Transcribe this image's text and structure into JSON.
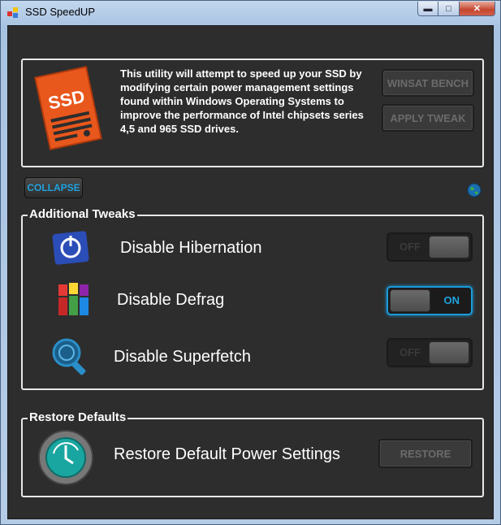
{
  "window": {
    "title": "SSD SpeedUP",
    "minimize": "▬",
    "maximize": "□",
    "close": "✕"
  },
  "intro": {
    "logo_text": "SSD",
    "description": "This utility will attempt to speed up your SSD by modifying certain power management settings found within Windows Operating Systems to improve the performance of Intel chipsets series 4,5 and 965 SSD drives.",
    "winsat_button": "WINSAT BENCH",
    "apply_button": "APPLY TWEAK"
  },
  "collapse_button": "COLLAPSE",
  "tweaks": {
    "legend": "Additional Tweaks",
    "items": [
      {
        "label": "Disable Hibernation",
        "state": "OFF",
        "icon": "hibernation-icon"
      },
      {
        "label": "Disable Defrag",
        "state": "ON",
        "icon": "defrag-icon"
      },
      {
        "label": "Disable Superfetch",
        "state": "OFF",
        "icon": "superfetch-icon"
      }
    ]
  },
  "restore": {
    "legend": "Restore Defaults",
    "label": "Restore Default Power Settings",
    "button": "RESTORE",
    "icon": "restore-clock-icon"
  },
  "colors": {
    "accent": "#1fa3e0",
    "background": "#2d2d2d",
    "logo_orange": "#e8571c"
  }
}
